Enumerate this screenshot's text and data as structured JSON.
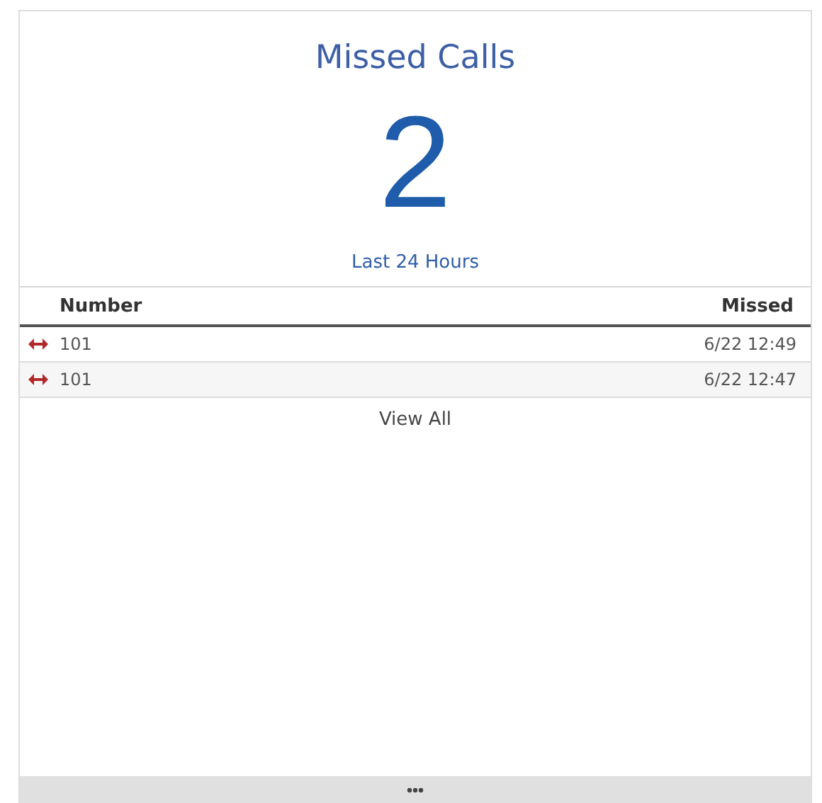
{
  "title": "Missed Calls",
  "count": "2",
  "period": "Last 24 Hours",
  "table": {
    "columns": [
      "Number",
      "Missed"
    ],
    "rows": [
      {
        "number": "101",
        "missed": "6/22 12:49"
      },
      {
        "number": "101",
        "missed": "6/22 12:47"
      }
    ]
  },
  "link": "View All"
}
